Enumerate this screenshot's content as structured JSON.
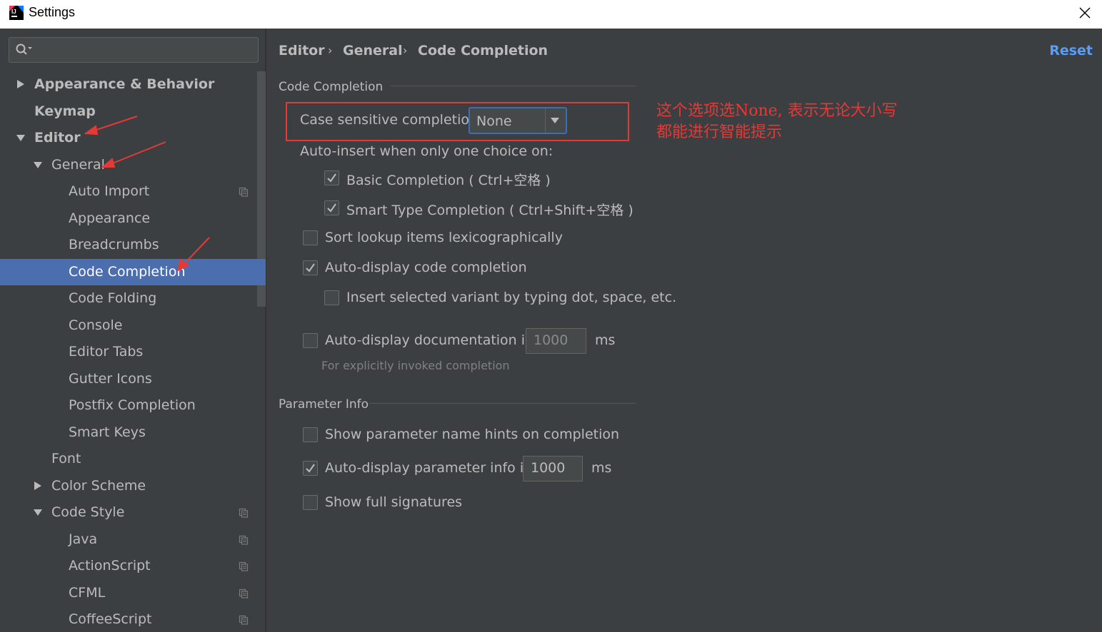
{
  "window": {
    "title": "Settings"
  },
  "search": {
    "placeholder": ""
  },
  "tree": [
    {
      "label": "Appearance & Behavior",
      "level": 0,
      "arrow": "collapsed",
      "bold": true
    },
    {
      "label": "Keymap",
      "level": 0,
      "arrow": "none",
      "bold": true
    },
    {
      "label": "Editor",
      "level": 0,
      "arrow": "expanded",
      "bold": true
    },
    {
      "label": "General",
      "level": 1,
      "arrow": "expanded"
    },
    {
      "label": "Auto Import",
      "level": 2,
      "arrow": "none",
      "project": true
    },
    {
      "label": "Appearance",
      "level": 2,
      "arrow": "none"
    },
    {
      "label": "Breadcrumbs",
      "level": 2,
      "arrow": "none"
    },
    {
      "label": "Code Completion",
      "level": 2,
      "arrow": "none",
      "selected": true
    },
    {
      "label": "Code Folding",
      "level": 2,
      "arrow": "none"
    },
    {
      "label": "Console",
      "level": 2,
      "arrow": "none"
    },
    {
      "label": "Editor Tabs",
      "level": 2,
      "arrow": "none"
    },
    {
      "label": "Gutter Icons",
      "level": 2,
      "arrow": "none"
    },
    {
      "label": "Postfix Completion",
      "level": 2,
      "arrow": "none"
    },
    {
      "label": "Smart Keys",
      "level": 2,
      "arrow": "none"
    },
    {
      "label": "Font",
      "level": 1,
      "arrow": "none"
    },
    {
      "label": "Color Scheme",
      "level": 1,
      "arrow": "collapsed"
    },
    {
      "label": "Code Style",
      "level": 1,
      "arrow": "expanded",
      "project": true
    },
    {
      "label": "Java",
      "level": 2,
      "arrow": "none",
      "project": true
    },
    {
      "label": "ActionScript",
      "level": 2,
      "arrow": "none",
      "project": true
    },
    {
      "label": "CFML",
      "level": 2,
      "arrow": "none",
      "project": true
    },
    {
      "label": "CoffeeScript",
      "level": 2,
      "arrow": "none",
      "project": true
    }
  ],
  "breadcrumb": {
    "editor": "Editor",
    "general": "General",
    "current": "Code Completion",
    "sep": "›"
  },
  "reset_label": "Reset",
  "code_completion": {
    "group_title": "Code Completion",
    "case_sensitive_label": "Case sensitive completion:",
    "case_sensitive_value": "None",
    "auto_insert_label": "Auto-insert when only one choice on:",
    "basic_completion": {
      "label": "Basic Completion ( Ctrl+空格 )",
      "checked": true
    },
    "smart_type_completion": {
      "label": "Smart Type Completion ( Ctrl+Shift+空格 )",
      "checked": true
    },
    "sort_lexicographically": {
      "label": "Sort lookup items lexicographically",
      "checked": false
    },
    "auto_display_completion": {
      "label": "Auto-display code completion",
      "checked": true
    },
    "insert_selected_variant": {
      "label": "Insert selected variant by typing dot, space, etc.",
      "checked": false
    },
    "auto_display_documentation": {
      "label": "Auto-display documentation in",
      "checked": false,
      "value": "1000",
      "unit": "ms"
    },
    "documentation_hint": "For explicitly invoked completion"
  },
  "parameter_info": {
    "group_title": "Parameter Info",
    "show_name_hints": {
      "label": "Show parameter name hints on completion",
      "checked": false
    },
    "auto_display_param_info": {
      "label": "Auto-display parameter info in",
      "checked": true,
      "value": "1000",
      "unit": "ms"
    },
    "show_full_signatures": {
      "label": "Show full signatures",
      "checked": false
    }
  },
  "annotation": {
    "line1": "这个选项选None, 表示无论大小写",
    "line2": "都能进行智能提示",
    "color": "#e53935"
  },
  "colors": {
    "selection": "#4b6eaf",
    "link": "#589df6",
    "background": "#3c3f41"
  }
}
